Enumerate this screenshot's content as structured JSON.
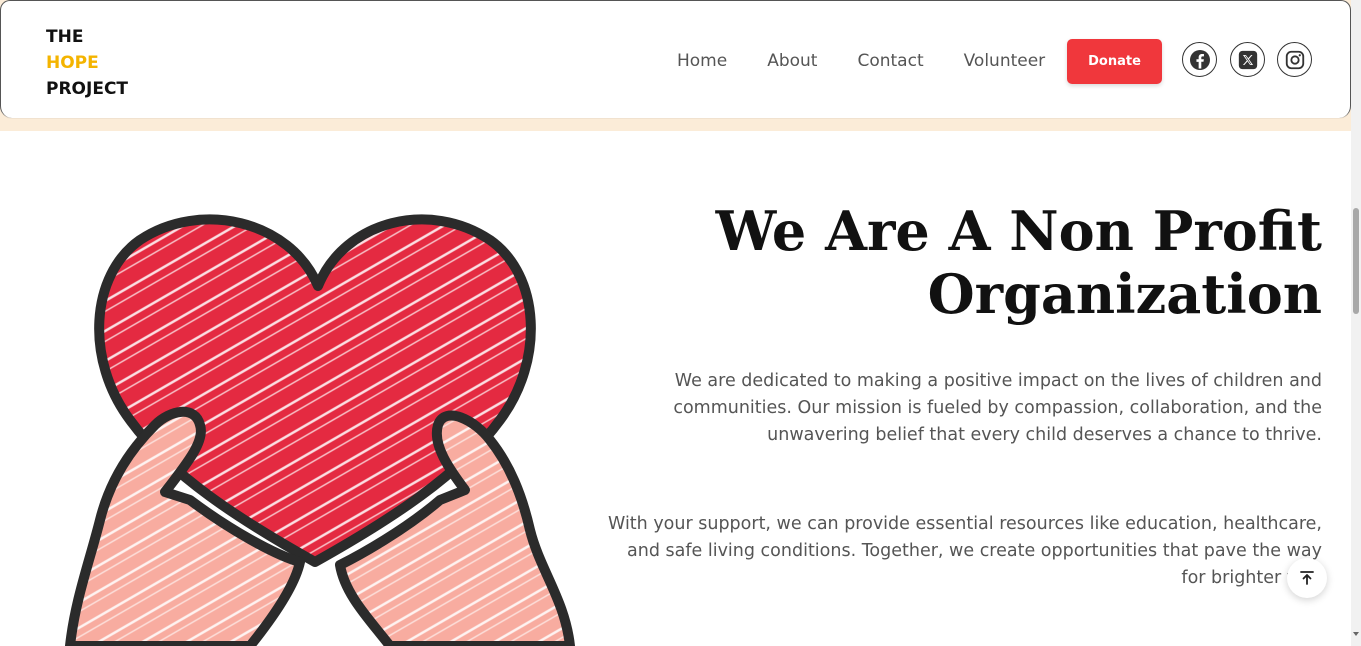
{
  "brand": {
    "line1": "THE",
    "line2": "HOPE",
    "line3": "PROJECT"
  },
  "nav": {
    "items": [
      "Home",
      "About",
      "Contact",
      "Volunteer"
    ]
  },
  "donate_label": "Donate",
  "social": [
    "facebook-icon",
    "x-twitter-icon",
    "instagram-icon"
  ],
  "colors": {
    "accent_yellow": "#f4b400",
    "donate_red": "#f0373c",
    "header_band": "#fbecd8",
    "heart_red": "#e42a41",
    "hand_pink": "#f8aca0"
  },
  "hero": {
    "title": "We Are A Non Profit Organization",
    "paragraph1": "We are dedicated to making a positive impact on the lives of children and communities. Our mission is fueled by compassion, collaboration, and the unwavering belief that every child deserves a chance to thrive.",
    "paragraph2": "With your support, we can provide essential resources like education, healthcare, and safe living conditions. Together, we create opportunities that pave the way for brighter futu"
  },
  "back_to_top_icon": "arrow-up-to-line-icon"
}
